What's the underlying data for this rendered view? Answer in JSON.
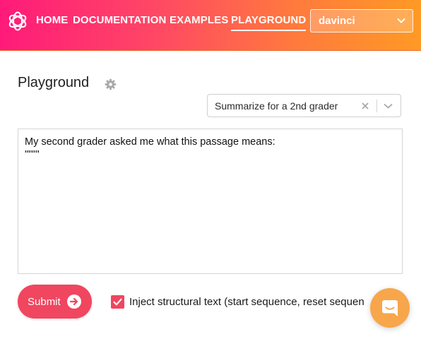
{
  "nav": {
    "items": [
      {
        "label": "HOME"
      },
      {
        "label": "DOCUMENTATION"
      },
      {
        "label": "EXAMPLES"
      },
      {
        "label": "PLAYGROUND",
        "active": true
      }
    ]
  },
  "engine_select": {
    "value": "davinci"
  },
  "page": {
    "title": "Playground"
  },
  "preset_select": {
    "value": "Summarize for a 2nd grader"
  },
  "prompt": {
    "value": "My second grader asked me what this passage means:\n\"\"\"\""
  },
  "submit": {
    "label": "Submit"
  },
  "inject_option": {
    "checked": true,
    "label": "Inject structural text (start sequence, reset sequen"
  },
  "colors": {
    "accent": "#f0465f",
    "header_start": "#ff1a7a",
    "header_end": "#ff9a24",
    "chat_button": "#f7a64b"
  },
  "icons": {
    "logo": "openai-logo-icon",
    "settings": "gear-icon",
    "clear": "close-icon",
    "dropdown": "chevron-down-icon",
    "submit": "arrow-right-circle-icon",
    "checkbox": "checkmark-icon",
    "chat": "chat-bubble-icon"
  }
}
